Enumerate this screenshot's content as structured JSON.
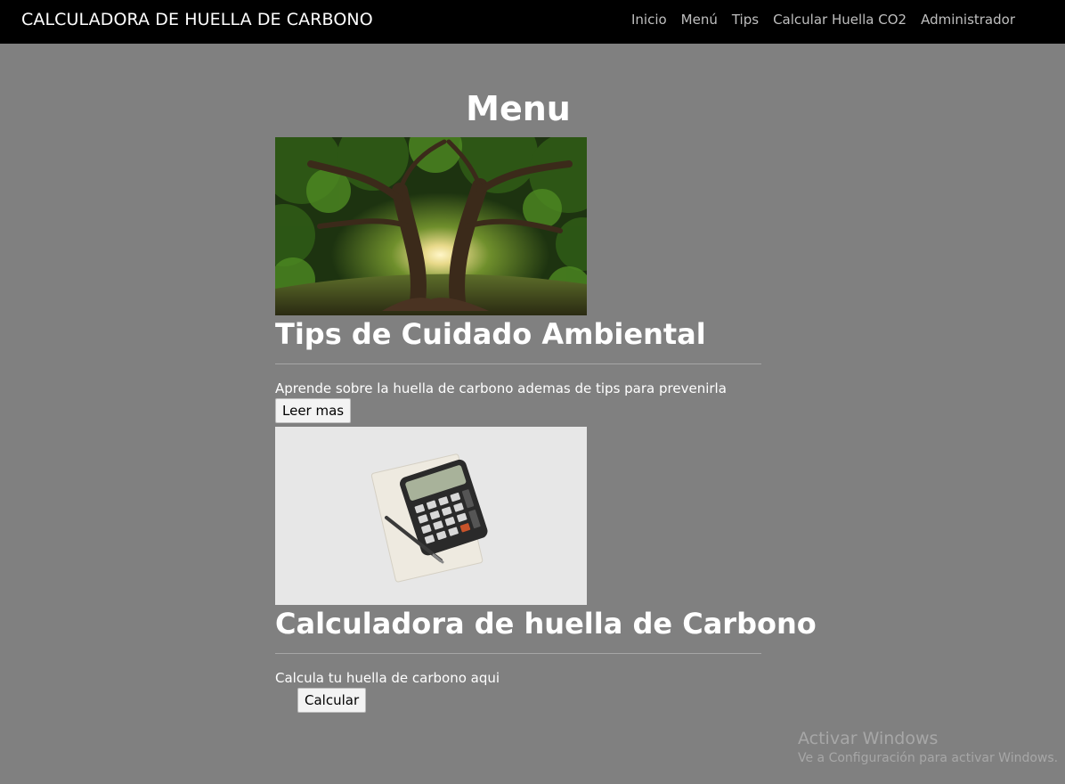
{
  "navbar": {
    "brand": "CALCULADORA DE HUELLA DE CARBONO",
    "links": [
      "Inicio",
      "Menú",
      "Tips",
      "Calcular Huella CO2",
      "Administrador"
    ]
  },
  "page": {
    "title": "Menu"
  },
  "cards": [
    {
      "image": "tree-photo",
      "title": "Tips de Cuidado Ambiental",
      "text": "Aprende sobre la huella de carbono ademas de tips para prevenirla",
      "button": "Leer mas"
    },
    {
      "image": "calculator-photo",
      "title": "Calculadora de huella de Carbono",
      "text": "Calcula tu huella de carbono aqui",
      "button": "Calcular"
    }
  ],
  "watermark": {
    "title": "Activar Windows",
    "subtitle": "Ve a Configuración para activar Windows."
  },
  "colors": {
    "navbar_bg": "#000000",
    "page_bg": "#808080",
    "nav_link": "#bfbfbf"
  }
}
